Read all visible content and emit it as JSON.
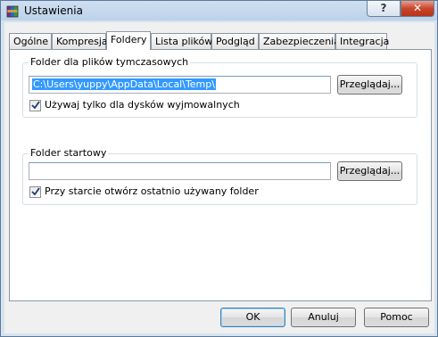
{
  "window": {
    "title": "Ustawienia",
    "help_label": "?",
    "close_label": "✕",
    "app_icon": "winrar-books-icon"
  },
  "tabs": [
    {
      "label": "Ogólne",
      "active": false
    },
    {
      "label": "Kompresja",
      "active": false
    },
    {
      "label": "Foldery",
      "active": true
    },
    {
      "label": "Lista plików",
      "active": false
    },
    {
      "label": "Podgląd",
      "active": false
    },
    {
      "label": "Zabezpieczenia",
      "active": false
    },
    {
      "label": "Integracja",
      "active": false
    }
  ],
  "temp_folder": {
    "group_label": "Folder dla plików tymczasowych",
    "path_value": "C:\\Users\\yuppy\\AppData\\Local\\Temp\\",
    "browse_label": "Przeglądaj...",
    "removable_only_label": "Używaj tylko dla dysków wyjmowalnych",
    "removable_only_checked": true
  },
  "start_folder": {
    "group_label": "Folder startowy",
    "path_value": "",
    "browse_label": "Przeglądaj...",
    "open_last_label": "Przy starcie otwórz ostatnio używany folder",
    "open_last_checked": true
  },
  "buttons": {
    "ok": "OK",
    "cancel": "Anuluj",
    "help": "Pomoc"
  }
}
